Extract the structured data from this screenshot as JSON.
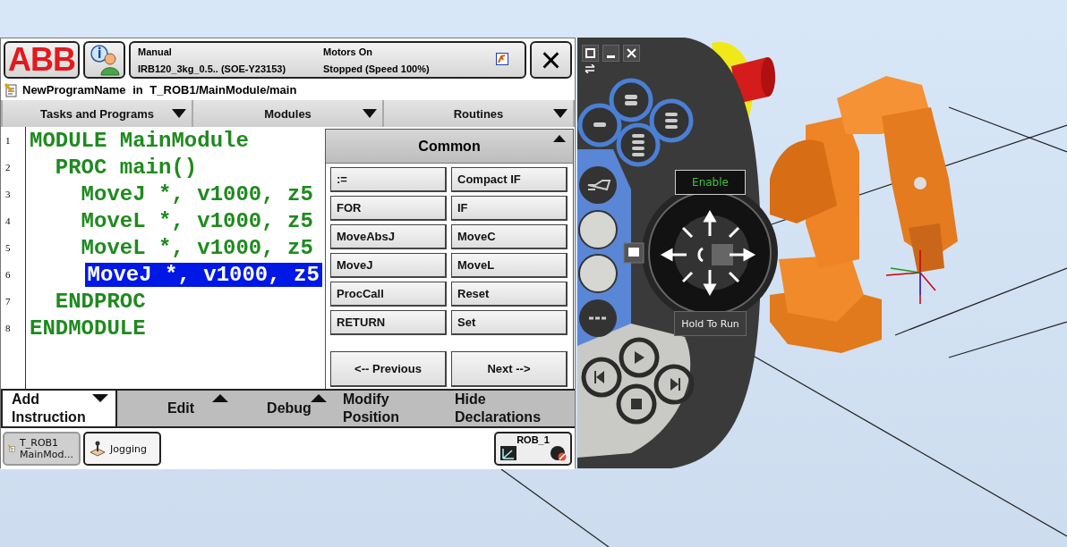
{
  "header": {
    "logo": "ABB",
    "mode": "Manual",
    "system": "IRB120_3kg_0.5.. (SOE-Y23153)",
    "motors": "Motors On",
    "state": "Stopped (Speed 100%)",
    "close": "×"
  },
  "title": "NewProgramName in T_ROB1/MainModule/main",
  "menus": [
    {
      "label": "Tasks and Programs"
    },
    {
      "label": "Modules"
    },
    {
      "label": "Routines"
    }
  ],
  "code": [
    {
      "number": "1",
      "text": "MODULE MainModule",
      "selected": false,
      "children": [
        {
          "number": "2",
          "text": "PROC main()",
          "selected": false,
          "children": [
            {
              "number": "3",
              "text": "MoveJ *, v1000, z5",
              "selected": false
            },
            {
              "number": "4",
              "text": "MoveL *, v1000, z5",
              "selected": false
            },
            {
              "number": "5",
              "text": "MoveL *, v1000, z5",
              "selected": false
            },
            {
              "number": "6",
              "text": "MoveJ *, v1000, z5",
              "selected": true
            }
          ]
        },
        {
          "number": "7",
          "text": "ENDPROC",
          "selected": false
        }
      ]
    },
    {
      "number": "8",
      "text": "ENDMODULE",
      "selected": false
    }
  ],
  "instruction_panel": {
    "title": "Common",
    "instructions": [
      ":=",
      "Compact IF",
      "FOR",
      "IF",
      "MoveAbsJ",
      "MoveC",
      "MoveJ",
      "MoveL",
      "ProcCall",
      "Reset",
      "RETURN",
      "Set"
    ],
    "previous": "<-- Previous",
    "next": "Next -->"
  },
  "bottom_menu": [
    {
      "label": "Add Instruction",
      "selected": true,
      "kind": "dropdown"
    },
    {
      "label": "Edit",
      "selected": false,
      "kind": "popup"
    },
    {
      "label": "Debug",
      "selected": false,
      "kind": "popup"
    },
    {
      "label": "Modify Position",
      "selected": false,
      "kind": "action"
    },
    {
      "label": "Hide Declarations",
      "selected": false,
      "kind": "action"
    }
  ],
  "taskbar": {
    "items": [
      {
        "kind": "program",
        "lines": [
          "T_ROB1",
          "MainMod..."
        ],
        "selected": true
      },
      {
        "kind": "jogging",
        "lines": [
          "Jogging"
        ],
        "selected": false
      }
    ],
    "quickset": "ROB_1"
  },
  "controller": {
    "enable": "Enable",
    "hold_to_run": "Hold To Run"
  }
}
